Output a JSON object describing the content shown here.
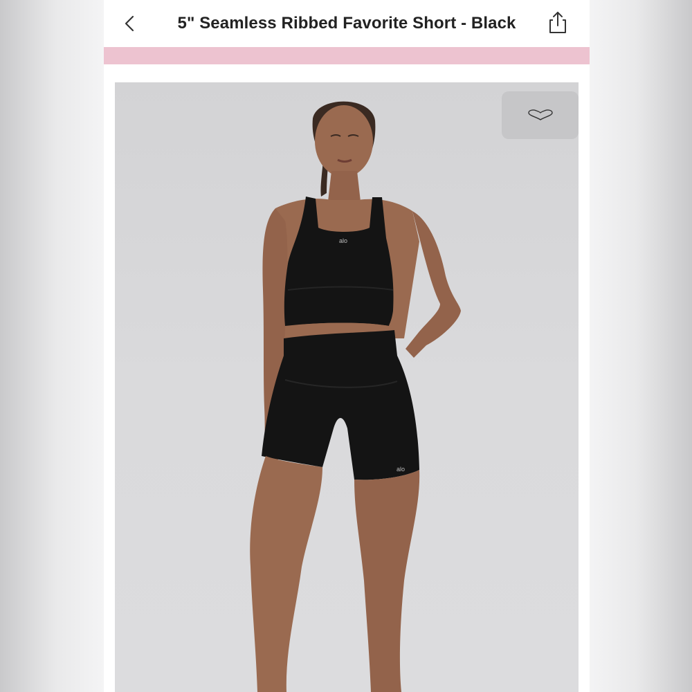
{
  "header": {
    "title": "5\" Seamless Ribbed Favorite Short - Black",
    "back_icon": "chevron-left-icon",
    "share_icon": "share-icon"
  },
  "banner": {
    "color": "#edc3d0"
  },
  "product_image": {
    "description_icon": "product-photo",
    "logo_top": "alo",
    "logo_shorts": "alo",
    "like_icon": "heart-icon"
  },
  "colors": {
    "background": "#ffffff",
    "title_text": "#222222",
    "photo_background": "#d8d8da",
    "garment": "#141414"
  }
}
